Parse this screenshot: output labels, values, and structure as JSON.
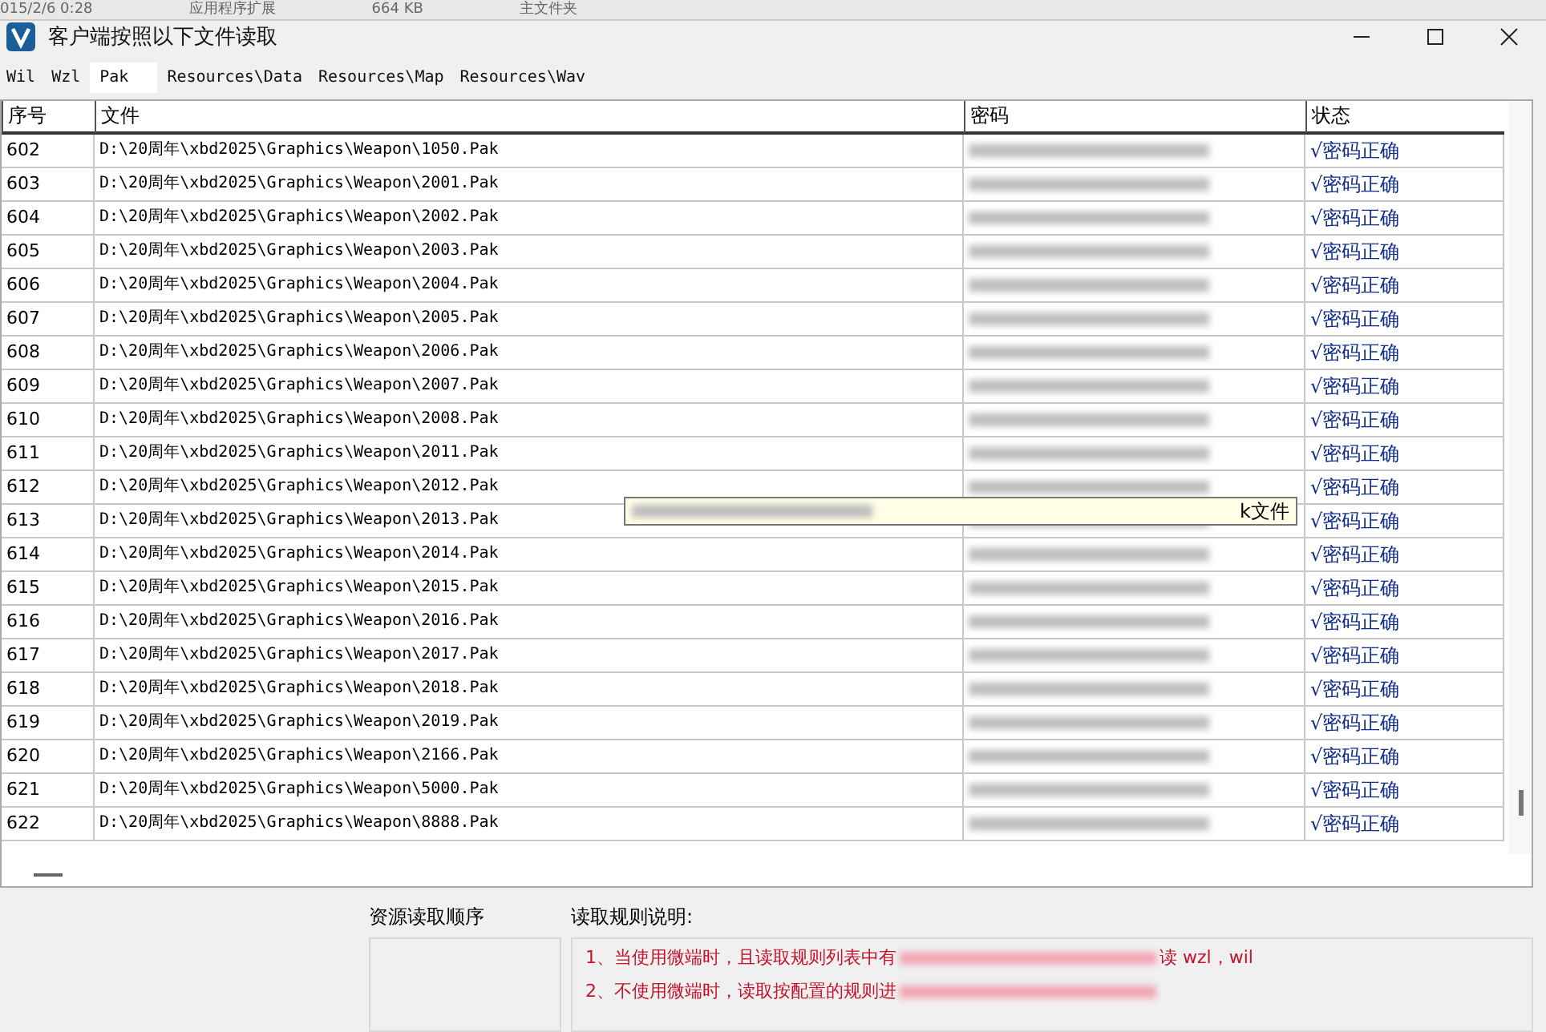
{
  "background_window": {
    "texts": [
      "015/2/6 0:28",
      "应用程序扩展",
      "664 KB",
      "主文件夹"
    ]
  },
  "window": {
    "title": "客户端按照以下文件读取"
  },
  "tabs": [
    {
      "label": "Wil",
      "selected": false
    },
    {
      "label": "Wzl",
      "selected": false
    },
    {
      "label": "Pak",
      "selected": true
    },
    {
      "label": "Resources\\Data",
      "selected": false
    },
    {
      "label": "Resources\\Map",
      "selected": false
    },
    {
      "label": "Resources\\Wav",
      "selected": false
    }
  ],
  "table": {
    "columns": [
      "序号",
      "文件",
      "密码",
      "状态"
    ],
    "rows": [
      {
        "index": "602",
        "file": "D:\\20周年\\xbd2025\\Graphics\\Weapon\\1050.Pak",
        "status": "√密码正确"
      },
      {
        "index": "603",
        "file": "D:\\20周年\\xbd2025\\Graphics\\Weapon\\2001.Pak",
        "status": "√密码正确"
      },
      {
        "index": "604",
        "file": "D:\\20周年\\xbd2025\\Graphics\\Weapon\\2002.Pak",
        "status": "√密码正确"
      },
      {
        "index": "605",
        "file": "D:\\20周年\\xbd2025\\Graphics\\Weapon\\2003.Pak",
        "status": "√密码正确"
      },
      {
        "index": "606",
        "file": "D:\\20周年\\xbd2025\\Graphics\\Weapon\\2004.Pak",
        "status": "√密码正确"
      },
      {
        "index": "607",
        "file": "D:\\20周年\\xbd2025\\Graphics\\Weapon\\2005.Pak",
        "status": "√密码正确"
      },
      {
        "index": "608",
        "file": "D:\\20周年\\xbd2025\\Graphics\\Weapon\\2006.Pak",
        "status": "√密码正确"
      },
      {
        "index": "609",
        "file": "D:\\20周年\\xbd2025\\Graphics\\Weapon\\2007.Pak",
        "status": "√密码正确"
      },
      {
        "index": "610",
        "file": "D:\\20周年\\xbd2025\\Graphics\\Weapon\\2008.Pak",
        "status": "√密码正确"
      },
      {
        "index": "611",
        "file": "D:\\20周年\\xbd2025\\Graphics\\Weapon\\2011.Pak",
        "status": "√密码正确"
      },
      {
        "index": "612",
        "file": "D:\\20周年\\xbd2025\\Graphics\\Weapon\\2012.Pak",
        "status": "√密码正确"
      },
      {
        "index": "613",
        "file": "D:\\20周年\\xbd2025\\Graphics\\Weapon\\2013.Pak",
        "status": "√密码正确"
      },
      {
        "index": "614",
        "file": "D:\\20周年\\xbd2025\\Graphics\\Weapon\\2014.Pak",
        "status": "√密码正确"
      },
      {
        "index": "615",
        "file": "D:\\20周年\\xbd2025\\Graphics\\Weapon\\2015.Pak",
        "status": "√密码正确"
      },
      {
        "index": "616",
        "file": "D:\\20周年\\xbd2025\\Graphics\\Weapon\\2016.Pak",
        "status": "√密码正确"
      },
      {
        "index": "617",
        "file": "D:\\20周年\\xbd2025\\Graphics\\Weapon\\2017.Pak",
        "status": "√密码正确"
      },
      {
        "index": "618",
        "file": "D:\\20周年\\xbd2025\\Graphics\\Weapon\\2018.Pak",
        "status": "√密码正确"
      },
      {
        "index": "619",
        "file": "D:\\20周年\\xbd2025\\Graphics\\Weapon\\2019.Pak",
        "status": "√密码正确"
      },
      {
        "index": "620",
        "file": "D:\\20周年\\xbd2025\\Graphics\\Weapon\\2166.Pak",
        "status": "√密码正确"
      },
      {
        "index": "621",
        "file": "D:\\20周年\\xbd2025\\Graphics\\Weapon\\5000.Pak",
        "status": "√密码正确"
      },
      {
        "index": "622",
        "file": "D:\\20周年\\xbd2025\\Graphics\\Weapon\\8888.Pak",
        "status": "√密码正确"
      }
    ]
  },
  "tooltip": {
    "text": "k文件"
  },
  "resource_order": {
    "label": "资源读取顺序"
  },
  "rules": {
    "label": "读取规则说明:",
    "lines": [
      {
        "start": "1、当使用微端时，且读取规则列表中有",
        "end": "读 wzl，wil"
      },
      {
        "start": "2、不使用微端时，读取按配置的规则进"
      }
    ]
  }
}
